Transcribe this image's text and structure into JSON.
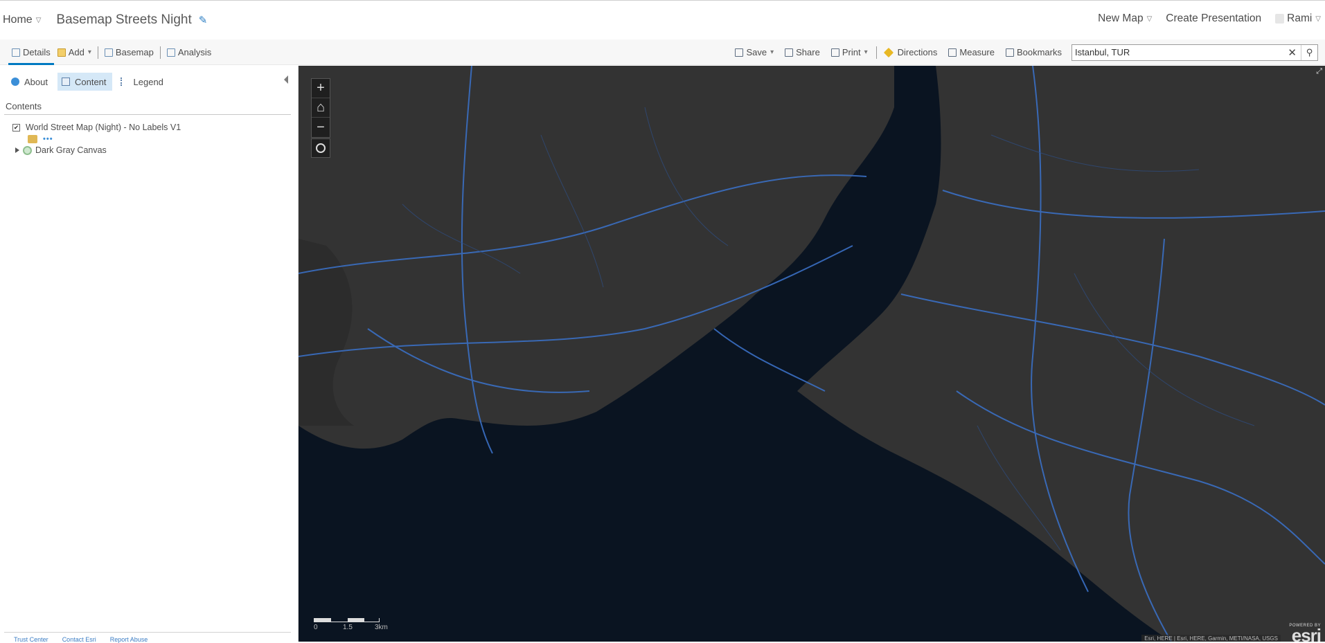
{
  "header": {
    "home_label": "Home",
    "map_title": "Basemap Streets Night",
    "new_map_label": "New Map",
    "create_presentation_label": "Create Presentation",
    "user_name": "Rami"
  },
  "toolbar": {
    "details_label": "Details",
    "add_label": "Add",
    "basemap_label": "Basemap",
    "analysis_label": "Analysis",
    "save_label": "Save",
    "share_label": "Share",
    "print_label": "Print",
    "directions_label": "Directions",
    "measure_label": "Measure",
    "bookmarks_label": "Bookmarks",
    "search_value": "Istanbul, TUR"
  },
  "sidebar": {
    "tabs": [
      {
        "label": "About",
        "icon": "info-icon",
        "active": false
      },
      {
        "label": "Content",
        "icon": "content-icon",
        "active": true
      },
      {
        "label": "Legend",
        "icon": "legend-icon",
        "active": false
      }
    ],
    "contents_heading": "Contents",
    "layers": [
      {
        "name": "World Street Map (Night) - No Labels V1",
        "checked": true
      },
      {
        "name": "Dark Gray Canvas"
      }
    ],
    "footer_links": [
      "Trust Center",
      "Contact Esri",
      "Report Abuse"
    ]
  },
  "map": {
    "zoom_in": "+",
    "zoom_out": "−",
    "scale_labels": [
      "0",
      "1.5",
      "3km"
    ],
    "attribution": "Esri, HERE | Esri, HERE, Garmin, METI/NASA, USGS",
    "powered_by": "POWERED BY",
    "logo_text": "esri",
    "colors": {
      "water": "#0a1421",
      "land": "#333333",
      "roads": "#3a6fc4"
    }
  }
}
